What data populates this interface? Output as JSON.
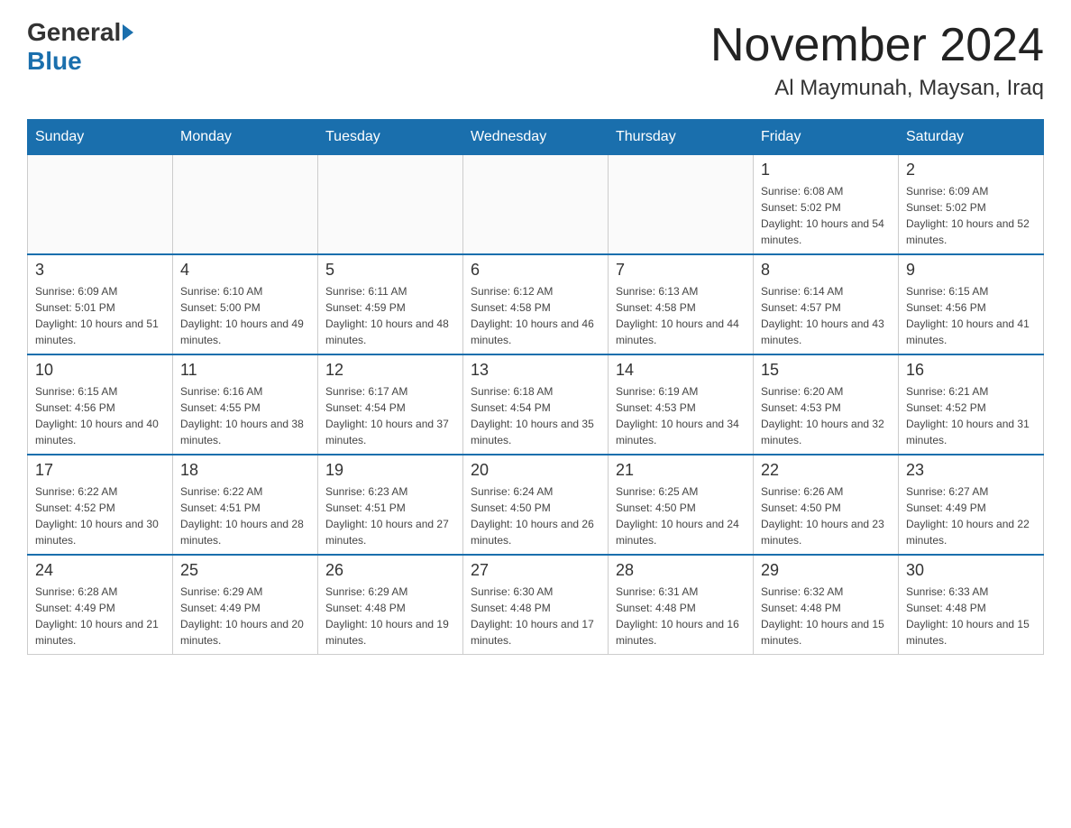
{
  "header": {
    "logo_general": "General",
    "logo_blue": "Blue",
    "title": "November 2024",
    "subtitle": "Al Maymunah, Maysan, Iraq"
  },
  "calendar": {
    "days_of_week": [
      "Sunday",
      "Monday",
      "Tuesday",
      "Wednesday",
      "Thursday",
      "Friday",
      "Saturday"
    ],
    "weeks": [
      [
        {
          "day": "",
          "info": ""
        },
        {
          "day": "",
          "info": ""
        },
        {
          "day": "",
          "info": ""
        },
        {
          "day": "",
          "info": ""
        },
        {
          "day": "",
          "info": ""
        },
        {
          "day": "1",
          "info": "Sunrise: 6:08 AM\nSunset: 5:02 PM\nDaylight: 10 hours and 54 minutes."
        },
        {
          "day": "2",
          "info": "Sunrise: 6:09 AM\nSunset: 5:02 PM\nDaylight: 10 hours and 52 minutes."
        }
      ],
      [
        {
          "day": "3",
          "info": "Sunrise: 6:09 AM\nSunset: 5:01 PM\nDaylight: 10 hours and 51 minutes."
        },
        {
          "day": "4",
          "info": "Sunrise: 6:10 AM\nSunset: 5:00 PM\nDaylight: 10 hours and 49 minutes."
        },
        {
          "day": "5",
          "info": "Sunrise: 6:11 AM\nSunset: 4:59 PM\nDaylight: 10 hours and 48 minutes."
        },
        {
          "day": "6",
          "info": "Sunrise: 6:12 AM\nSunset: 4:58 PM\nDaylight: 10 hours and 46 minutes."
        },
        {
          "day": "7",
          "info": "Sunrise: 6:13 AM\nSunset: 4:58 PM\nDaylight: 10 hours and 44 minutes."
        },
        {
          "day": "8",
          "info": "Sunrise: 6:14 AM\nSunset: 4:57 PM\nDaylight: 10 hours and 43 minutes."
        },
        {
          "day": "9",
          "info": "Sunrise: 6:15 AM\nSunset: 4:56 PM\nDaylight: 10 hours and 41 minutes."
        }
      ],
      [
        {
          "day": "10",
          "info": "Sunrise: 6:15 AM\nSunset: 4:56 PM\nDaylight: 10 hours and 40 minutes."
        },
        {
          "day": "11",
          "info": "Sunrise: 6:16 AM\nSunset: 4:55 PM\nDaylight: 10 hours and 38 minutes."
        },
        {
          "day": "12",
          "info": "Sunrise: 6:17 AM\nSunset: 4:54 PM\nDaylight: 10 hours and 37 minutes."
        },
        {
          "day": "13",
          "info": "Sunrise: 6:18 AM\nSunset: 4:54 PM\nDaylight: 10 hours and 35 minutes."
        },
        {
          "day": "14",
          "info": "Sunrise: 6:19 AM\nSunset: 4:53 PM\nDaylight: 10 hours and 34 minutes."
        },
        {
          "day": "15",
          "info": "Sunrise: 6:20 AM\nSunset: 4:53 PM\nDaylight: 10 hours and 32 minutes."
        },
        {
          "day": "16",
          "info": "Sunrise: 6:21 AM\nSunset: 4:52 PM\nDaylight: 10 hours and 31 minutes."
        }
      ],
      [
        {
          "day": "17",
          "info": "Sunrise: 6:22 AM\nSunset: 4:52 PM\nDaylight: 10 hours and 30 minutes."
        },
        {
          "day": "18",
          "info": "Sunrise: 6:22 AM\nSunset: 4:51 PM\nDaylight: 10 hours and 28 minutes."
        },
        {
          "day": "19",
          "info": "Sunrise: 6:23 AM\nSunset: 4:51 PM\nDaylight: 10 hours and 27 minutes."
        },
        {
          "day": "20",
          "info": "Sunrise: 6:24 AM\nSunset: 4:50 PM\nDaylight: 10 hours and 26 minutes."
        },
        {
          "day": "21",
          "info": "Sunrise: 6:25 AM\nSunset: 4:50 PM\nDaylight: 10 hours and 24 minutes."
        },
        {
          "day": "22",
          "info": "Sunrise: 6:26 AM\nSunset: 4:50 PM\nDaylight: 10 hours and 23 minutes."
        },
        {
          "day": "23",
          "info": "Sunrise: 6:27 AM\nSunset: 4:49 PM\nDaylight: 10 hours and 22 minutes."
        }
      ],
      [
        {
          "day": "24",
          "info": "Sunrise: 6:28 AM\nSunset: 4:49 PM\nDaylight: 10 hours and 21 minutes."
        },
        {
          "day": "25",
          "info": "Sunrise: 6:29 AM\nSunset: 4:49 PM\nDaylight: 10 hours and 20 minutes."
        },
        {
          "day": "26",
          "info": "Sunrise: 6:29 AM\nSunset: 4:48 PM\nDaylight: 10 hours and 19 minutes."
        },
        {
          "day": "27",
          "info": "Sunrise: 6:30 AM\nSunset: 4:48 PM\nDaylight: 10 hours and 17 minutes."
        },
        {
          "day": "28",
          "info": "Sunrise: 6:31 AM\nSunset: 4:48 PM\nDaylight: 10 hours and 16 minutes."
        },
        {
          "day": "29",
          "info": "Sunrise: 6:32 AM\nSunset: 4:48 PM\nDaylight: 10 hours and 15 minutes."
        },
        {
          "day": "30",
          "info": "Sunrise: 6:33 AM\nSunset: 4:48 PM\nDaylight: 10 hours and 15 minutes."
        }
      ]
    ]
  }
}
